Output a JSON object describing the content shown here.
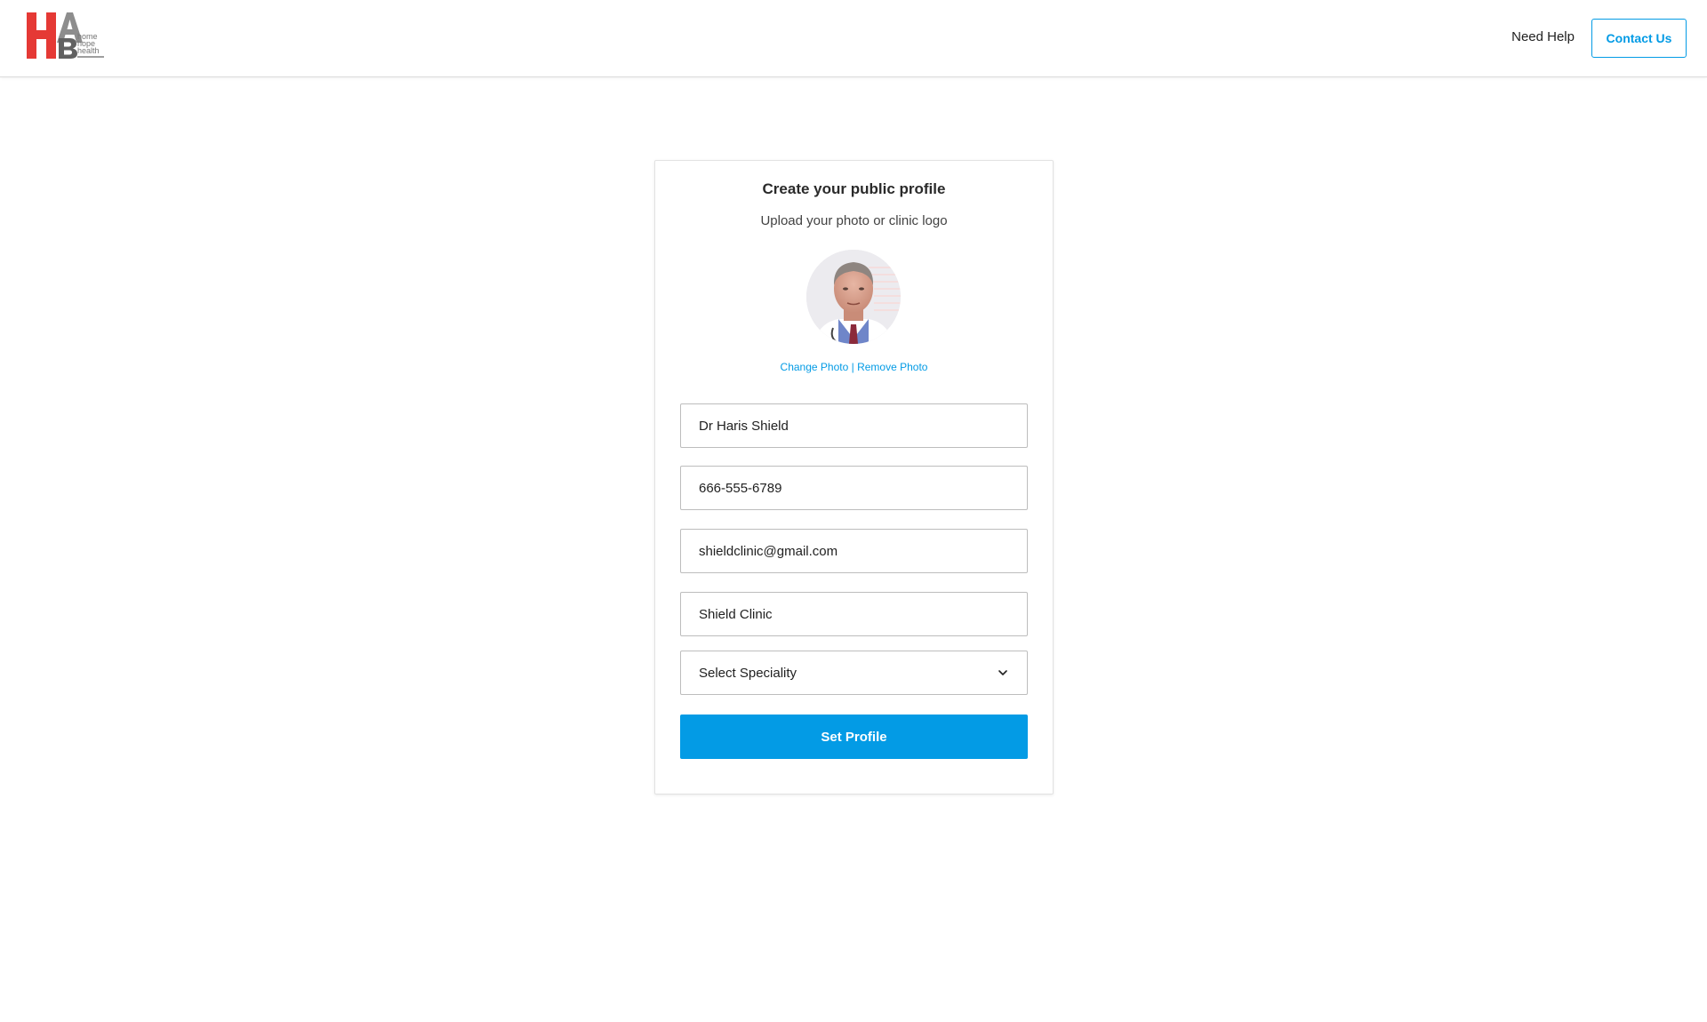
{
  "header": {
    "logo_text": "HAB home hope health",
    "need_help_label": "Need Help",
    "contact_label": "Contact Us"
  },
  "profile_card": {
    "title": "Create your public profile",
    "subtitle": "Upload your photo or clinic logo",
    "change_photo_label": "Change Photo",
    "separator": "|",
    "remove_photo_label": "Remove Photo",
    "fields": {
      "name": {
        "value": "Dr Haris Shield"
      },
      "phone": {
        "value": "666-555-6789"
      },
      "email": {
        "value": "shieldclinic@gmail.com"
      },
      "clinic": {
        "value": "Shield Clinic"
      },
      "speciality": {
        "selected": "Select Speciality"
      }
    },
    "submit_label": "Set Profile"
  },
  "colors": {
    "accent": "#039be5",
    "logo_red": "#e53935",
    "logo_gray": "#757575"
  }
}
